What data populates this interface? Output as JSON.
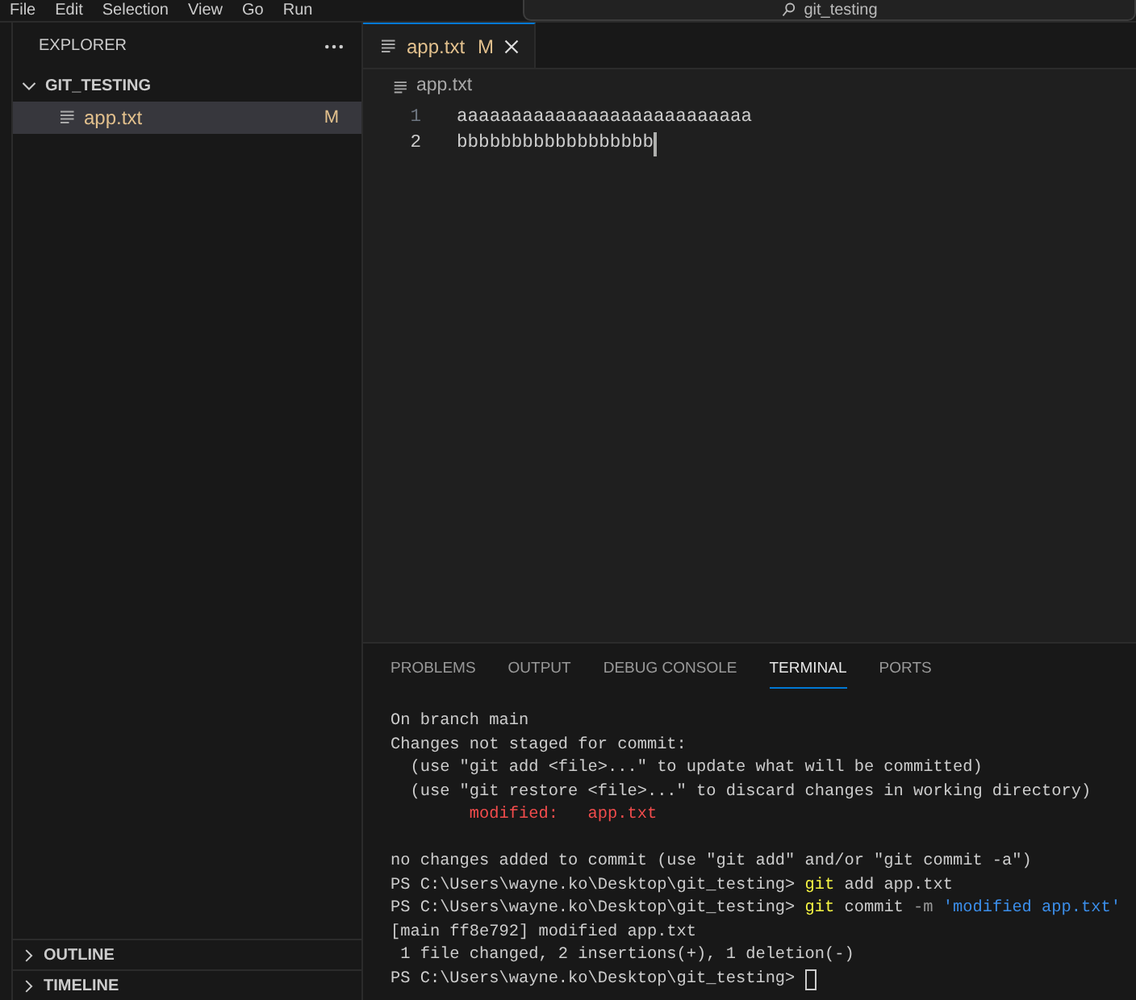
{
  "menu_bar": {
    "items": [
      "File",
      "Edit",
      "Selection",
      "View",
      "Go",
      "Run"
    ],
    "search": {
      "value": "git_testing"
    }
  },
  "explorer": {
    "title": "EXPLORER",
    "folder": {
      "label": "GIT_TESTING",
      "expanded": true,
      "files": [
        {
          "label": "app.txt",
          "badge": "M",
          "selected": true
        }
      ]
    },
    "sections": [
      {
        "label": "OUTLINE",
        "expanded": false
      },
      {
        "label": "TIMELINE",
        "expanded": false
      }
    ]
  },
  "editor": {
    "tabs": [
      {
        "label": "app.txt",
        "badge": "M",
        "selected": true
      }
    ],
    "breadcrumb": "app.txt",
    "lines": [
      {
        "number": "1",
        "text": "aaaaaaaaaaaaaaaaaaaaaaaaaaa",
        "current": false
      },
      {
        "number": "2",
        "text": "bbbbbbbbbbbbbbbbbb",
        "current": true
      }
    ]
  },
  "panel": {
    "tabs": [
      {
        "label": "PROBLEMS",
        "selected": false
      },
      {
        "label": "OUTPUT",
        "selected": false
      },
      {
        "label": "DEBUG CONSOLE",
        "selected": false
      },
      {
        "label": "TERMINAL",
        "selected": true
      },
      {
        "label": "PORTS",
        "selected": false
      }
    ],
    "terminal": {
      "lines": [
        {
          "kind": "text",
          "segments": [
            {
              "text": "On branch main",
              "kind": "plain"
            }
          ]
        },
        {
          "kind": "text",
          "segments": [
            {
              "text": "Changes not staged for commit:",
              "kind": "plain"
            }
          ]
        },
        {
          "kind": "text",
          "segments": [
            {
              "text": "  (use \"git add <file>...\" to update what will be committed)",
              "kind": "plain"
            }
          ]
        },
        {
          "kind": "text",
          "segments": [
            {
              "text": "  (use \"git restore <file>...\" to discard changes in working directory)",
              "kind": "plain"
            }
          ]
        },
        {
          "kind": "text",
          "segments": [
            {
              "text": "        modified:   app.txt",
              "kind": "error"
            }
          ]
        },
        {
          "kind": "blank"
        },
        {
          "kind": "text",
          "segments": [
            {
              "text": "no changes added to commit (use \"git add\" and/or \"git commit -a\")",
              "kind": "plain"
            }
          ]
        },
        {
          "kind": "text",
          "segments": [
            {
              "text": "PS C:\\Users\\wayne.ko\\Desktop\\git_testing> ",
              "kind": "plain"
            },
            {
              "text": "git",
              "kind": "command"
            },
            {
              "text": " add app.txt",
              "kind": "plain"
            }
          ]
        },
        {
          "kind": "text",
          "segments": [
            {
              "text": "PS C:\\Users\\wayne.ko\\Desktop\\git_testing> ",
              "kind": "plain"
            },
            {
              "text": "git",
              "kind": "command"
            },
            {
              "text": " commit ",
              "kind": "plain"
            },
            {
              "text": "-m",
              "kind": "flag"
            },
            {
              "text": " 'modified app.txt'",
              "kind": "string"
            }
          ]
        },
        {
          "kind": "text",
          "segments": [
            {
              "text": "[main ff8e792] modified app.txt",
              "kind": "plain"
            }
          ]
        },
        {
          "kind": "text",
          "segments": [
            {
              "text": " 1 file changed, 2 insertions(+), 1 deletion(-)",
              "kind": "plain"
            }
          ]
        },
        {
          "kind": "text",
          "cursor": true,
          "segments": [
            {
              "text": "PS C:\\Users\\wayne.ko\\Desktop\\git_testing> ",
              "kind": "plain"
            }
          ]
        }
      ]
    }
  }
}
